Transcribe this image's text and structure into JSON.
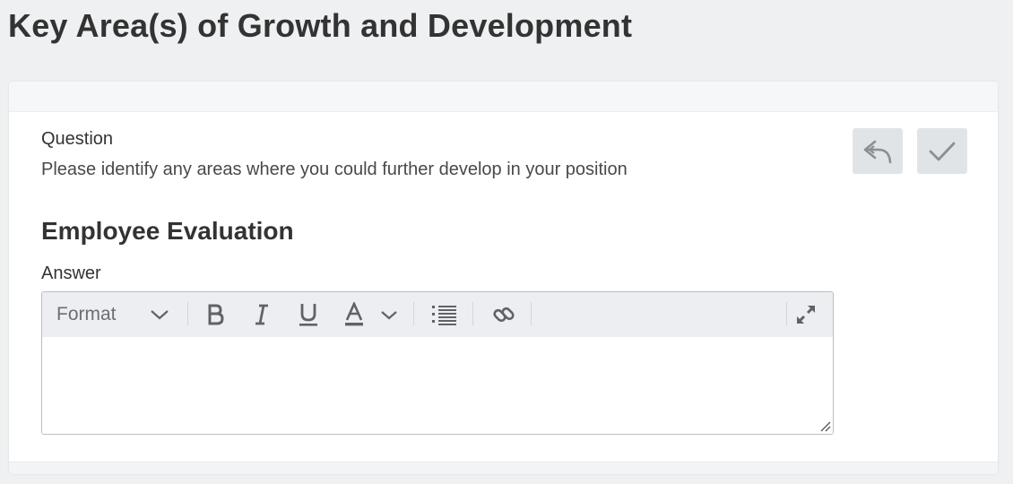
{
  "page": {
    "title": "Key Area(s) of Growth and Development"
  },
  "question": {
    "label": "Question",
    "text": "Please identify any areas where you could further develop in your position"
  },
  "actions": {
    "undo_icon": "undo-icon",
    "confirm_icon": "check-icon"
  },
  "section": {
    "title": "Employee Evaluation"
  },
  "answer": {
    "label": "Answer",
    "value": "",
    "toolbar": {
      "format_label": "Format",
      "icons": [
        "bold-icon",
        "italic-icon",
        "underline-icon",
        "font-color-icon",
        "bullet-list-icon",
        "link-icon",
        "expand-icon"
      ]
    }
  },
  "colors": {
    "background": "#eef0f2",
    "card": "#ffffff",
    "toolbar": "#eceef1",
    "icon": "#5f6368",
    "action_button": "#e1e4e7"
  }
}
